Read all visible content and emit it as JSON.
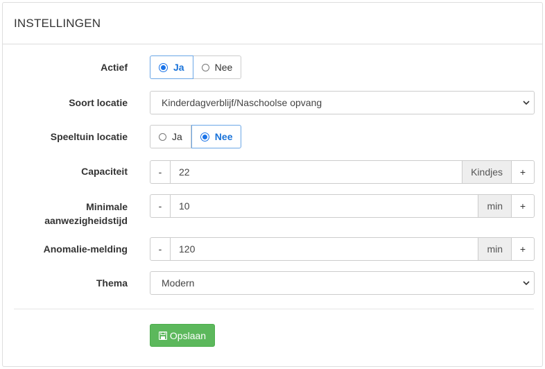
{
  "panel": {
    "title": "INSTELLINGEN"
  },
  "fields": {
    "actief": {
      "label": "Actief",
      "options": [
        "Ja",
        "Nee"
      ],
      "selected": "Ja"
    },
    "soort_locatie": {
      "label": "Soort locatie",
      "value": "Kinderdagverblijf/Naschoolse opvang"
    },
    "speeltuin_locatie": {
      "label": "Speeltuin locatie",
      "options": [
        "Ja",
        "Nee"
      ],
      "selected": "Nee"
    },
    "capaciteit": {
      "label": "Capaciteit",
      "value": "22",
      "unit": "Kindjes",
      "minus": "-",
      "plus": "+"
    },
    "minimale": {
      "label_line1": "Minimale",
      "label_line2": "aanwezigheidstijd",
      "value": "10",
      "unit": "min",
      "minus": "-",
      "plus": "+"
    },
    "anomalie": {
      "label": "Anomalie-melding",
      "value": "120",
      "unit": "min",
      "minus": "-",
      "plus": "+"
    },
    "thema": {
      "label": "Thema",
      "value": "Modern"
    }
  },
  "save_button": {
    "label": "Opslaan",
    "color": "#5cb85c"
  },
  "icons": {
    "dropdown": "chevron-down-icon",
    "save": "floppy-disk-icon"
  },
  "colors": {
    "accent": "#1a73e8"
  }
}
